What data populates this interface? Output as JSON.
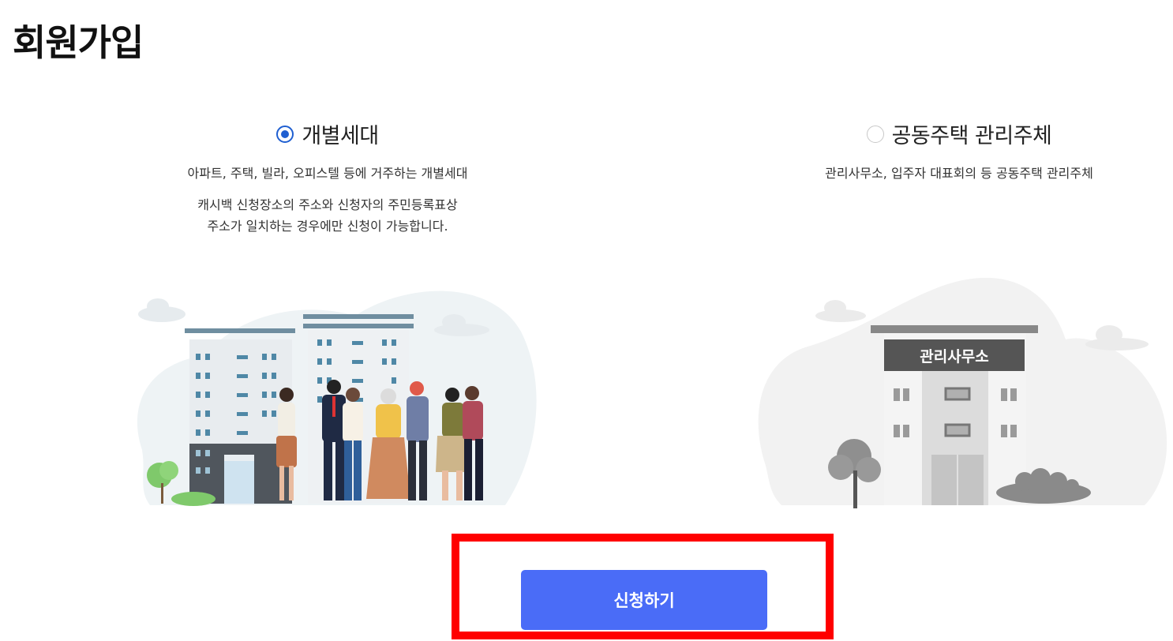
{
  "page": {
    "title": "회원가입"
  },
  "options": [
    {
      "label": "개별세대",
      "selected": true,
      "description": "아파트, 주택, 빌라, 오피스텔 등에 거주하는 개별세대",
      "note_line1": "캐시백 신청장소의 주소와 신청자의 주민등록표상",
      "note_line2": "주소가 일치하는 경우에만 신청이 가능합니다."
    },
    {
      "label": "공동주택 관리주체",
      "selected": false,
      "description": "관리사무소, 입주자 대표회의 등 공동주택 관리주체",
      "building_sign": "관리사무소"
    }
  ],
  "submit": {
    "label": "신청하기"
  },
  "colors": {
    "accent": "#4a6cf7",
    "radio_selected": "#1f5fd1",
    "highlight_frame": "#ff0000"
  }
}
